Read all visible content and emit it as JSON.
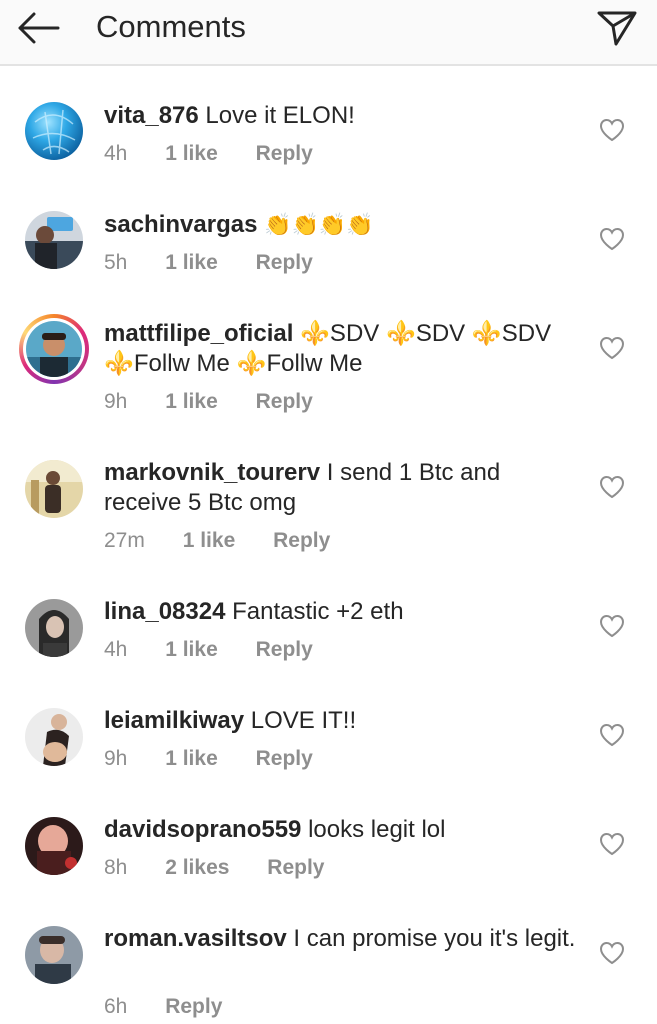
{
  "header": {
    "title": "Comments",
    "back_icon": "arrow-left-icon",
    "send_icon": "paper-plane-icon"
  },
  "colors": {
    "text": "#262626",
    "muted": "#8e8e8e",
    "header_bg": "#fafafa",
    "divider": "#e3e3e3"
  },
  "comments": [
    {
      "username": "vita_876",
      "text": "Love it ELON!",
      "time": "4h",
      "likes": "1 like",
      "reply": "Reply"
    },
    {
      "username": "sachinvargas",
      "text": "👏👏👏👏",
      "time": "5h",
      "likes": "1 like",
      "reply": "Reply"
    },
    {
      "username": "mattfilipe_oficial",
      "text": "⚜️SDV ⚜️SDV ⚜️SDV ⚜️Follw Me ⚜️Follw Me",
      "time": "9h",
      "likes": "1 like",
      "reply": "Reply",
      "has_story": true
    },
    {
      "username": "markovnik_tourerv",
      "text": "I send 1 Btc and receive 5 Btc omg",
      "time": "27m",
      "likes": "1 like",
      "reply": "Reply"
    },
    {
      "username": "lina_08324",
      "text": "Fantastic +2 eth",
      "time": "4h",
      "likes": "1 like",
      "reply": "Reply"
    },
    {
      "username": "leiamilkiway",
      "text": "LOVE IT!!",
      "time": "9h",
      "likes": "1 like",
      "reply": "Reply"
    },
    {
      "username": "davidsoprano559",
      "text": "looks legit lol",
      "time": "8h",
      "likes": "2 likes",
      "reply": "Reply"
    },
    {
      "username": "roman.vasiltsov",
      "text": "I can promise you it's legit.",
      "time": "6h",
      "likes": "",
      "reply": "Reply"
    }
  ]
}
